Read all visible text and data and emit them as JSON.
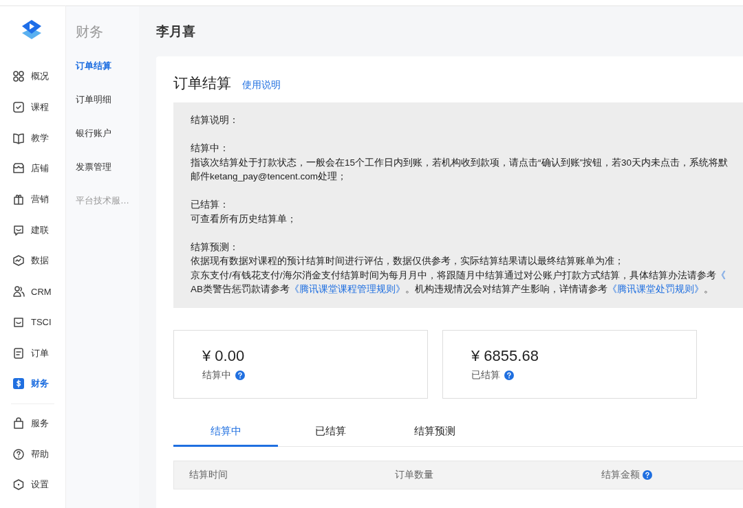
{
  "nav": {
    "items": [
      {
        "label": "概况",
        "selected": false
      },
      {
        "label": "课程",
        "selected": false
      },
      {
        "label": "教学",
        "selected": false
      },
      {
        "label": "店铺",
        "selected": false
      },
      {
        "label": "营销",
        "selected": false
      },
      {
        "label": "建联",
        "selected": false
      },
      {
        "label": "数据",
        "selected": false
      },
      {
        "label": "CRM",
        "selected": false
      },
      {
        "label": "TSCI",
        "selected": false
      },
      {
        "label": "订单",
        "selected": false
      },
      {
        "label": "财务",
        "selected": true
      }
    ],
    "bottom_items": [
      {
        "label": "服务"
      },
      {
        "label": "帮助"
      },
      {
        "label": "设置"
      }
    ]
  },
  "subnav": {
    "title": "财务",
    "items": [
      {
        "label": "订单结算",
        "selected": true,
        "disabled": false
      },
      {
        "label": "订单明细",
        "selected": false,
        "disabled": false
      },
      {
        "label": "银行账户",
        "selected": false,
        "disabled": false
      },
      {
        "label": "发票管理",
        "selected": false,
        "disabled": false
      },
      {
        "label": "平台技术服…",
        "selected": false,
        "disabled": true
      }
    ]
  },
  "header": {
    "title": "李月喜"
  },
  "page": {
    "title": "订单结算",
    "help_link": "使用说明"
  },
  "notice": {
    "sections": [
      [
        [
          {
            "kind": "text",
            "text": "结算说明："
          }
        ]
      ],
      [
        [
          {
            "kind": "text",
            "text": "结算中："
          }
        ],
        [
          {
            "kind": "text",
            "text": "指该次结算处于打款状态，一般会在15个工作日内到账，若机构收到款项，请点击“确认到账”按钮，若30天内未点击，系统将默"
          }
        ],
        [
          {
            "kind": "text",
            "text": "邮件ketang_pay@tencent.com处理；"
          }
        ]
      ],
      [
        [
          {
            "kind": "text",
            "text": "已结算："
          }
        ],
        [
          {
            "kind": "text",
            "text": "可查看所有历史结算单；"
          }
        ]
      ],
      [
        [
          {
            "kind": "text",
            "text": "结算预测："
          }
        ],
        [
          {
            "kind": "text",
            "text": "依据现有数据对课程的预计结算时间进行评估，数据仅供参考，实际结算结果请以最终结算账单为准；"
          }
        ],
        [
          {
            "kind": "text",
            "text": "京东支付/有钱花支付/海尔消金支付结算时间为每月月中，将跟随月中结算通过对公账户打款方式结算，具体结算办法请参考"
          },
          {
            "kind": "link",
            "text": "《"
          }
        ],
        [
          {
            "kind": "text",
            "text": "AB类警告惩罚款请参考"
          },
          {
            "kind": "link",
            "text": "《腾讯课堂课程管理规则》"
          },
          {
            "kind": "text",
            "text": "。机构违规情况会对结算产生影响，详情请参考"
          },
          {
            "kind": "link",
            "text": "《腾讯课堂处罚规则》"
          },
          {
            "kind": "text",
            "text": "。"
          }
        ]
      ]
    ]
  },
  "stats": [
    {
      "value": "¥ 0.00",
      "label": "结算中",
      "help": true
    },
    {
      "value": "¥ 6855.68",
      "label": "已结算",
      "help": true
    }
  ],
  "tabs": [
    {
      "label": "结算中",
      "selected": true
    },
    {
      "label": "已结算",
      "selected": false
    },
    {
      "label": "结算预测",
      "selected": false
    }
  ],
  "table": {
    "columns": [
      {
        "label": "结算时间",
        "help": false
      },
      {
        "label": "订单数量",
        "help": false
      },
      {
        "label": "结算金额",
        "help": true
      }
    ]
  }
}
